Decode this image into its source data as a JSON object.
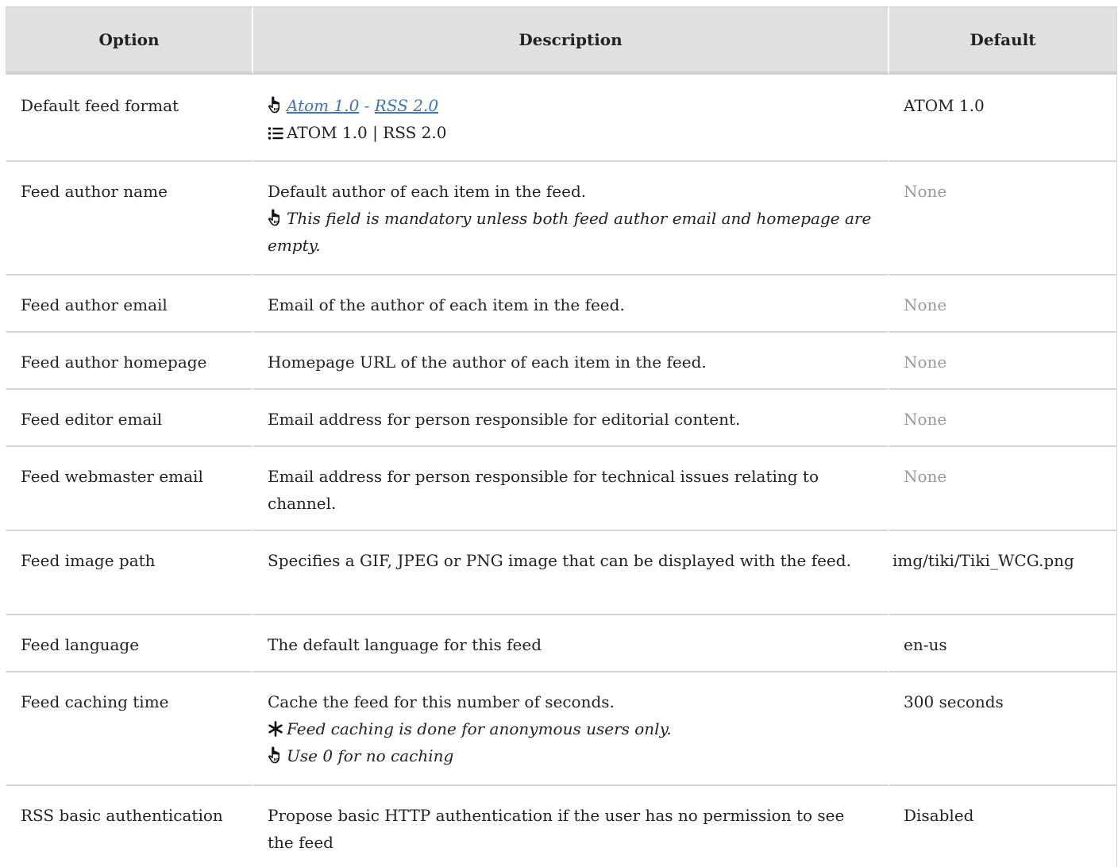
{
  "headers": {
    "option": "Option",
    "description": "Description",
    "default": "Default"
  },
  "rows": [
    {
      "option": "Default feed format",
      "links": [
        "Atom 1.0",
        "RSS 2.0"
      ],
      "link_sep": " - ",
      "choices": "ATOM 1.0 | RSS 2.0",
      "default": "ATOM 1.0"
    },
    {
      "option": "Feed author name",
      "desc": "Default author of each item in the feed.",
      "tip": "This field is mandatory unless both feed author email and homepage are empty.",
      "default": "None"
    },
    {
      "option": "Feed author email",
      "desc": "Email of the author of each item in the feed.",
      "default": "None"
    },
    {
      "option": "Feed author homepage",
      "desc": "Homepage URL of the author of each item in the feed.",
      "default": "None"
    },
    {
      "option": "Feed editor email",
      "desc": "Email address for person responsible for editorial content.",
      "default": "None"
    },
    {
      "option": "Feed webmaster email",
      "desc": "Email address for person responsible for technical issues relating to channel.",
      "default": "None"
    },
    {
      "option": "Feed image path",
      "desc": "Specifies a GIF, JPEG or PNG image that can be displayed with the feed.",
      "default": "img/tiki/Tiki_WCG.png"
    },
    {
      "option": "Feed language",
      "desc": "The default language for this feed",
      "default": "en-us"
    },
    {
      "option": "Feed caching time",
      "desc": "Cache the feed for this number of seconds.",
      "note": "Feed caching is done for anonymous users only.",
      "tip": "Use 0 for no caching",
      "default": "300 seconds"
    },
    {
      "option": "RSS basic authentication",
      "desc": "Propose basic HTTP authentication if the user has no permission to see the feed",
      "default": "Disabled"
    }
  ],
  "colors": {
    "header_bg": "#e0e0e0",
    "link": "#3a78b8",
    "muted": "#999999",
    "border": "#d6d6d6"
  },
  "icons": {
    "tip": "hand-pointer-icon",
    "list": "list-icon",
    "note": "asterisk-icon"
  }
}
